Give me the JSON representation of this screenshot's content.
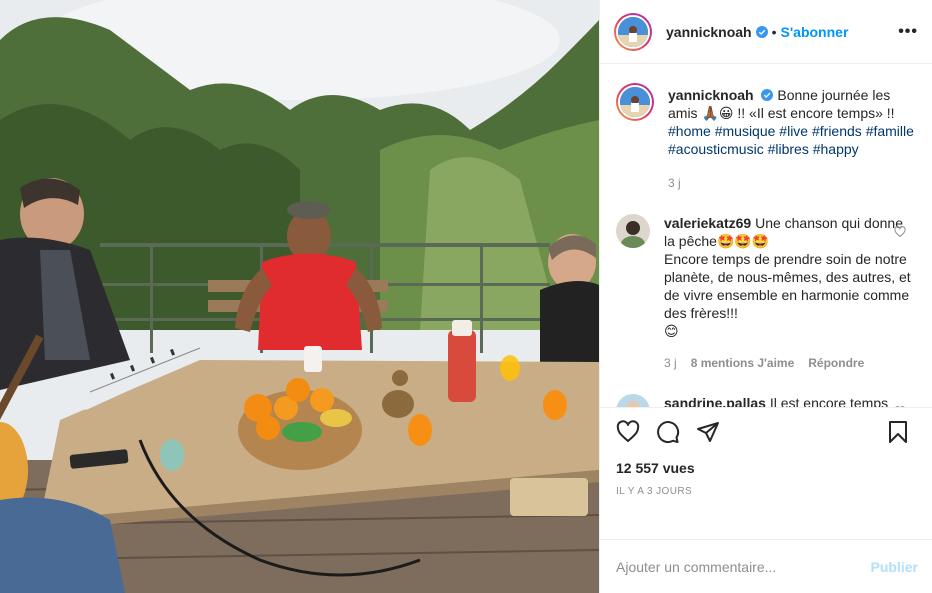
{
  "post": {
    "author": {
      "username": "yannicknoah",
      "verified": true,
      "follow_label": "S'abonner",
      "separator": "•"
    },
    "more_label": "•••",
    "caption": {
      "username": "yannicknoah",
      "text_part1": "Bonne journée les amis ",
      "emoji_a": "🙏🏾😀",
      "text_part2": " !! «Il est encore temps» !!",
      "hashtags": [
        "#home",
        "#musique",
        "#live",
        "#friends",
        "#famille",
        "#acousticmusic",
        "#libres",
        "#happy"
      ],
      "age": "3 j"
    },
    "comments": [
      {
        "username": "valeriekatz69",
        "text_line1": "Une chanson qui donne la pêche",
        "emoji_line1": "🤩🤩🤩",
        "text_line2": "Encore temps de prendre soin de notre planète, de nous-mêmes, des autres, et de vivre ensemble en harmonie comme des frères!!!",
        "emoji_line2": "😊",
        "age": "3 j",
        "likes": "8 mentions J'aime",
        "reply_label": "Répondre"
      },
      {
        "username": "sandrine.pallas",
        "text": "Il est encore temps ....de dire aux gens qu'on"
      }
    ],
    "views": "12 557 vues",
    "date": "IL Y A 3 JOURS",
    "comment_input": {
      "placeholder": "Ajouter un commentaire...",
      "value": ""
    },
    "publish_label": "Publier"
  },
  "colors": {
    "accent": "#0095f6",
    "hashtag": "#00376b",
    "muted": "#8e8e8e",
    "publish_disabled": "#b2dffc",
    "border": "#efefef"
  },
  "icons": [
    "verified-icon",
    "more-icon",
    "heart-icon",
    "comment-icon",
    "share-icon",
    "save-icon"
  ]
}
